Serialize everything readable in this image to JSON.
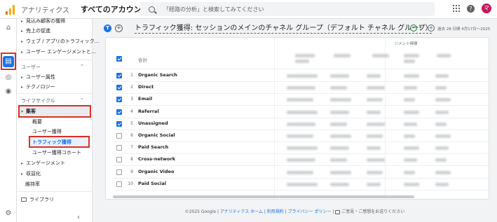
{
  "topbar": {
    "app_name": "アナリティクス",
    "account": "すべてのアカウント",
    "search_placeholder": "「経路の分析」と検索してみてください",
    "avatar_initial": "マ"
  },
  "sidenav": {
    "top_items": [
      {
        "label": "見込み顧客の獲得"
      },
      {
        "label": "売上の促進"
      },
      {
        "label": "ウェブ / アプリのトラフィック..."
      },
      {
        "label": "ユーザー エンゲージメントと..."
      }
    ],
    "user_section": "ユーザー",
    "user_items": [
      {
        "label": "ユーザー属性"
      },
      {
        "label": "テクノロジー"
      }
    ],
    "lifecycle_section": "ライフサイクル",
    "acquisition": "集客",
    "acquisition_children": [
      {
        "label": "概要"
      },
      {
        "label": "ユーザー獲得"
      },
      {
        "label": "トラフィック獲得"
      },
      {
        "label": "ユーザー獲得コホート"
      }
    ],
    "other_items": [
      {
        "label": "エンゲージメント"
      },
      {
        "label": "収益化"
      },
      {
        "label": "維持率"
      }
    ],
    "library": "ライブラリ"
  },
  "header": {
    "badge": "T",
    "title": "トラフィック獲得: セッションのメインのチャネル グループ（デフォルト チャネル グループ）",
    "date_range": "過去 28 日間  4月17日〜2025"
  },
  "table": {
    "column_header": "ジメント時間",
    "total_label": "合計",
    "rows": [
      {
        "index": "1",
        "label": "Organic Search",
        "checked": true
      },
      {
        "index": "2",
        "label": "Direct",
        "checked": true
      },
      {
        "index": "3",
        "label": "Email",
        "checked": true
      },
      {
        "index": "4",
        "label": "Referral",
        "checked": true
      },
      {
        "index": "5",
        "label": "Unassigned",
        "checked": true
      },
      {
        "index": "6",
        "label": "Organic Social",
        "checked": false
      },
      {
        "index": "7",
        "label": "Paid Search",
        "checked": false
      },
      {
        "index": "8",
        "label": "Cross-network",
        "checked": false
      },
      {
        "index": "9",
        "label": "Organic Video",
        "checked": false
      },
      {
        "index": "10",
        "label": "Paid Social",
        "checked": false
      }
    ]
  },
  "footer": {
    "copyright": "©2025 Google",
    "link_home": "アナリティクス ホーム",
    "link_terms": "利用規約",
    "link_privacy": "プライバシー ポリシー",
    "feedback": "ご意見・ご感想をお送りください"
  },
  "colors": {
    "accent": "#1a73e8",
    "highlight_border": "#d93025",
    "logo": "#f9ab00"
  }
}
